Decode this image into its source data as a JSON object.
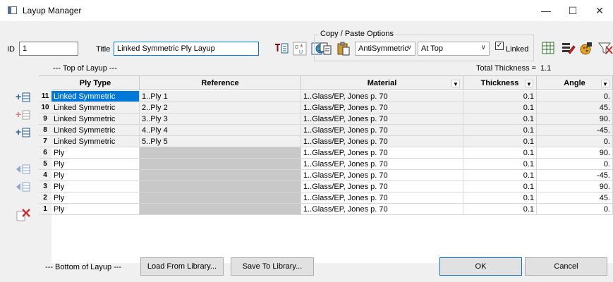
{
  "window": {
    "title": "Layup Manager",
    "minimize": "—",
    "maximize": "☐",
    "close": "✕"
  },
  "header": {
    "id_label": "ID",
    "id_value": "1",
    "title_label": "Title",
    "title_value": "Linked Symmetric Ply Layup"
  },
  "copy_paste": {
    "group_title": "Copy / Paste Options",
    "mode_value": "AntiSymmetric",
    "position_value": "At Top",
    "linked_label": "Linked",
    "linked_checked": true,
    "check_mark": "✓",
    "arrow": "∨"
  },
  "layup": {
    "top_label": "--- Top of Layup ---",
    "bottom_label": "--- Bottom of Layup ---",
    "total_thickness_label": "Total Thickness =",
    "total_thickness_value": "1.1"
  },
  "table": {
    "columns": [
      "Ply Type",
      "Reference",
      "Material",
      "Thickness",
      "Angle"
    ],
    "dropdown_glyph": "▼",
    "rows": [
      {
        "num": "11",
        "ply_type": "Linked Symmetric",
        "reference": "1..Ply 1",
        "material": "1..Glass/EP, Jones p. 70",
        "thickness": "0.1",
        "angle": "0."
      },
      {
        "num": "10",
        "ply_type": "Linked Symmetric",
        "reference": "2..Ply 2",
        "material": "1..Glass/EP, Jones p. 70",
        "thickness": "0.1",
        "angle": "45."
      },
      {
        "num": "9",
        "ply_type": "Linked Symmetric",
        "reference": "3..Ply 3",
        "material": "1..Glass/EP, Jones p. 70",
        "thickness": "0.1",
        "angle": "90."
      },
      {
        "num": "8",
        "ply_type": "Linked Symmetric",
        "reference": "4..Ply 4",
        "material": "1..Glass/EP, Jones p. 70",
        "thickness": "0.1",
        "angle": "-45."
      },
      {
        "num": "7",
        "ply_type": "Linked Symmetric",
        "reference": "5..Ply 5",
        "material": "1..Glass/EP, Jones p. 70",
        "thickness": "0.1",
        "angle": "0."
      },
      {
        "num": "6",
        "ply_type": "Ply",
        "reference": "",
        "material": "1..Glass/EP, Jones p. 70",
        "thickness": "0.1",
        "angle": "90."
      },
      {
        "num": "5",
        "ply_type": "Ply",
        "reference": "",
        "material": "1..Glass/EP, Jones p. 70",
        "thickness": "0.1",
        "angle": "0."
      },
      {
        "num": "4",
        "ply_type": "Ply",
        "reference": "",
        "material": "1..Glass/EP, Jones p. 70",
        "thickness": "0.1",
        "angle": "-45."
      },
      {
        "num": "3",
        "ply_type": "Ply",
        "reference": "",
        "material": "1..Glass/EP, Jones p. 70",
        "thickness": "0.1",
        "angle": "90."
      },
      {
        "num": "2",
        "ply_type": "Ply",
        "reference": "",
        "material": "1..Glass/EP, Jones p. 70",
        "thickness": "0.1",
        "angle": "45."
      },
      {
        "num": "1",
        "ply_type": "Ply",
        "reference": "",
        "material": "1..Glass/EP, Jones p. 70",
        "thickness": "0.1",
        "angle": "0."
      }
    ]
  },
  "buttons": {
    "load": "Load From Library...",
    "save": "Save To Library...",
    "ok": "OK",
    "cancel": "Cancel"
  },
  "colors": {
    "selection": "#0078d7",
    "disabled_cell": "#c8c8c8",
    "toolbar_icon": "#1e5a8c"
  },
  "icons": {
    "title_tools": [
      "text-insert-icon",
      "renumber-icon",
      "globe-icon"
    ],
    "copy_paste_tools": [
      "copy-icon",
      "paste-icon"
    ],
    "right_tools": [
      "spreadsheet-icon",
      "edit-icon",
      "color-icon",
      "filter-icon"
    ],
    "side_tools": [
      "insert-above-icon",
      "insert-below-icon",
      "add-row-icon",
      "move-up-icon",
      "move-down-icon",
      "delete-row-icon"
    ]
  }
}
